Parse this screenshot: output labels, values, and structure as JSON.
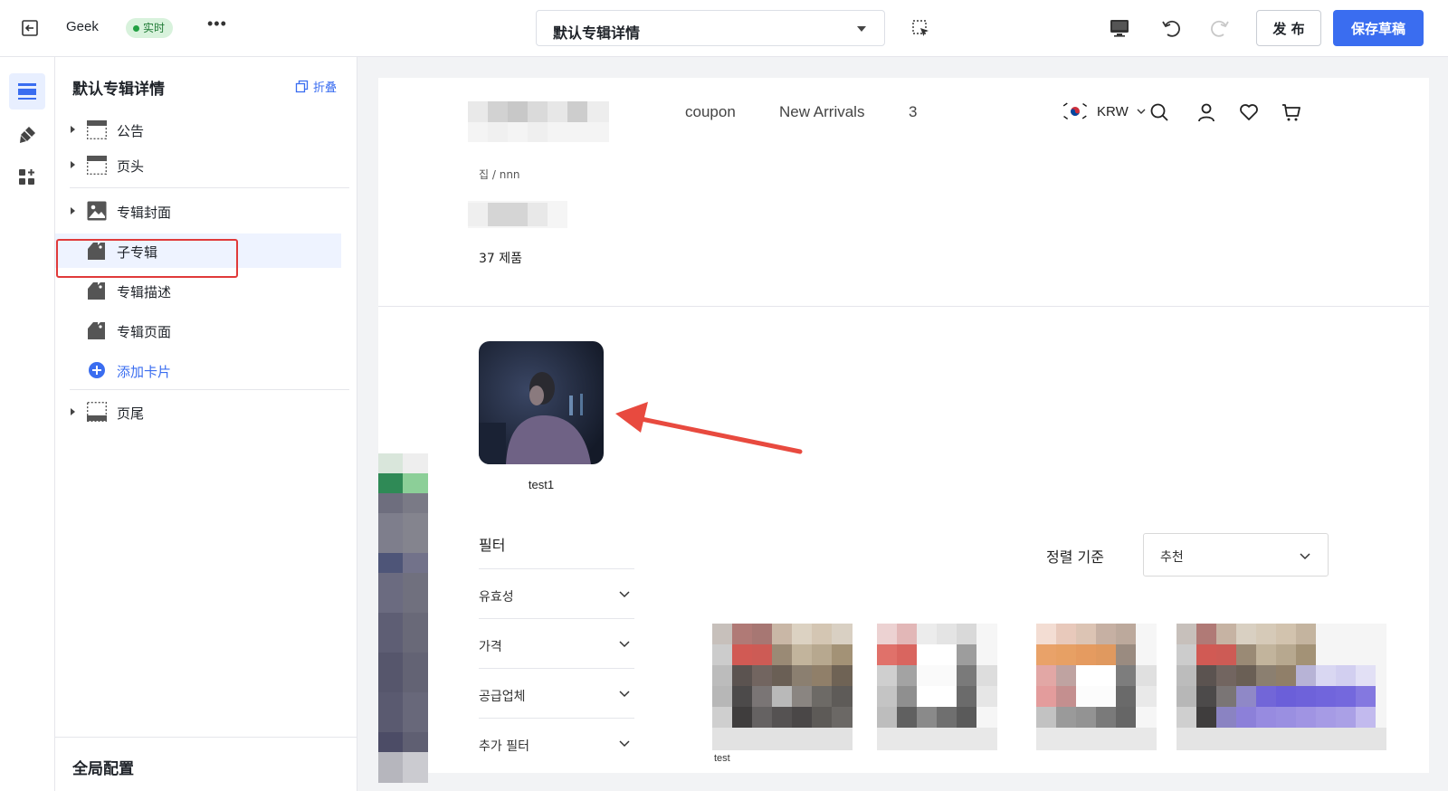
{
  "topbar": {
    "store_name": "Geek",
    "status_badge": "实时",
    "more": "•••",
    "page_select": "默认专辑详情",
    "publish_label": "发 布",
    "save_label": "保存草稿"
  },
  "panel": {
    "title": "默认专辑详情",
    "collapse_label": "折叠",
    "items": [
      {
        "label": "公告",
        "icon": "layout-header-icon"
      },
      {
        "label": "页头",
        "icon": "layout-header-icon"
      },
      {
        "label": "专辑封面",
        "icon": "image-icon"
      },
      {
        "label": "子专辑",
        "icon": "tag-icon"
      },
      {
        "label": "专辑描述",
        "icon": "tag-icon"
      },
      {
        "label": "专辑页面",
        "icon": "tag-icon"
      },
      {
        "label": "添加卡片",
        "icon": "plus-circle-icon"
      },
      {
        "label": "页尾",
        "icon": "layout-footer-icon"
      }
    ],
    "footer": "全局配置"
  },
  "preview": {
    "nav": [
      "coupon",
      "New Arrivals",
      "3"
    ],
    "currency": "KRW",
    "breadcrumb": "집 / nnn",
    "product_count": "37 제품",
    "sub_album_label": "test1",
    "filter_title": "필터",
    "filters": [
      "유효성",
      "가격",
      "공급업체",
      "추가 필터"
    ],
    "sort_label": "정렬 기준",
    "sort_value": "추천",
    "product_labels": [
      "test",
      "",
      "",
      ""
    ]
  },
  "colors": {
    "accent": "#3a6df0",
    "live_green": "#23a043",
    "highlight_red": "#e03a3a"
  }
}
